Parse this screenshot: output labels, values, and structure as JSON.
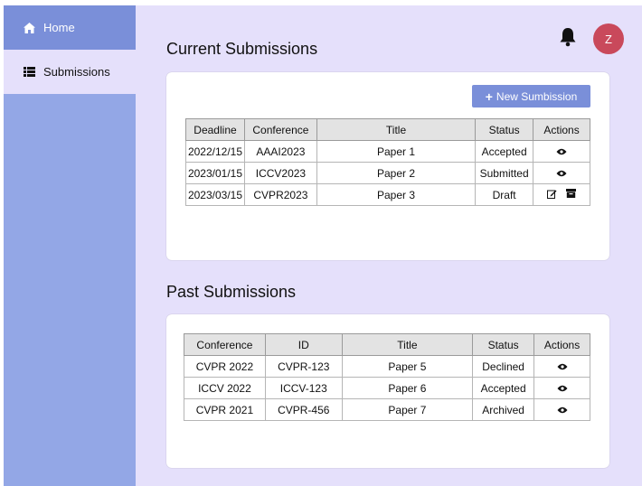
{
  "sidebar": {
    "items": [
      {
        "label": "Home",
        "icon": "home-icon"
      },
      {
        "label": "Submissions",
        "icon": "list-icon"
      }
    ]
  },
  "header": {
    "avatar_initial": "Z"
  },
  "current": {
    "title": "Current Submissions",
    "new_button_label": "New Sumbission",
    "columns": [
      "Deadline",
      "Conference",
      "Title",
      "Status",
      "Actions"
    ],
    "rows": [
      {
        "deadline": "2022/12/15",
        "conference": "AAAI2023",
        "title": "Paper 1",
        "status": "Accepted",
        "actions": [
          "view-icon"
        ]
      },
      {
        "deadline": "2023/01/15",
        "conference": "ICCV2023",
        "title": "Paper 2",
        "status": "Submitted",
        "actions": [
          "view-icon"
        ]
      },
      {
        "deadline": "2023/03/15",
        "conference": "CVPR2023",
        "title": "Paper 3",
        "status": "Draft",
        "actions": [
          "edit-icon",
          "archive-icon"
        ]
      }
    ]
  },
  "past": {
    "title": "Past Submissions",
    "columns": [
      "Conference",
      "ID",
      "Title",
      "Status",
      "Actions"
    ],
    "rows": [
      {
        "conference": "CVPR 2022",
        "id": "CVPR-123",
        "title": "Paper 5",
        "status": "Declined",
        "actions": [
          "view-icon"
        ]
      },
      {
        "conference": "ICCV 2022",
        "id": "ICCV-123",
        "title": "Paper 6",
        "status": "Accepted",
        "actions": [
          "view-icon"
        ]
      },
      {
        "conference": "CVPR 2021",
        "id": "CVPR-456",
        "title": "Paper 7",
        "status": "Archived",
        "actions": [
          "view-icon"
        ]
      }
    ]
  }
}
